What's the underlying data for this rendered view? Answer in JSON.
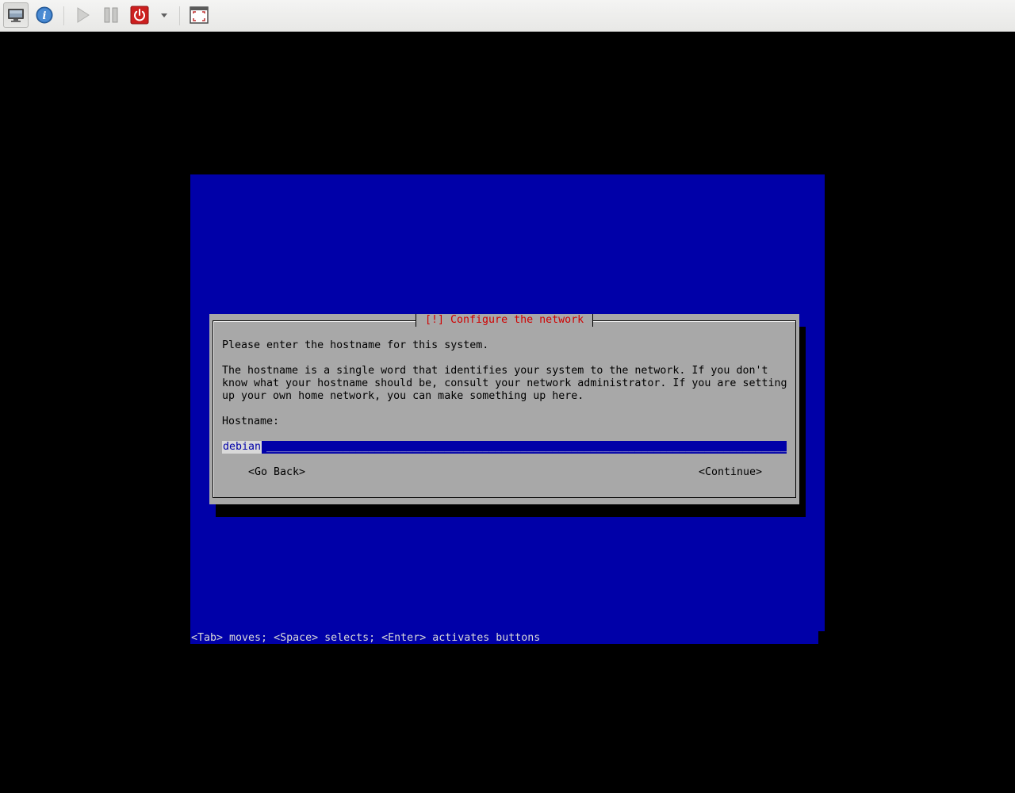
{
  "toolbar": {
    "items": [
      "display-icon",
      "info-icon",
      "play-icon",
      "pause-icon",
      "power-icon",
      "dropdown-icon",
      "fullscreen-icon"
    ]
  },
  "dialog": {
    "title": "[!] Configure the network",
    "prompt": "Please enter the hostname for this system.",
    "description": [
      "The hostname is a single word that identifies your system to the network. If you don't",
      "know what your hostname should be, consult your network administrator. If you are setting",
      "up your own home network, you can make something up here."
    ],
    "field_label": "Hostname:",
    "hostname_value": "debian",
    "go_back_label": "<Go Back>",
    "continue_label": "<Continue>"
  },
  "help_line": "<Tab> moves; <Space> selects; <Enter> activates buttons",
  "colors": {
    "console_bg": "#0000a8",
    "dialog_bg": "#a8a8a8",
    "title_red": "#d00000",
    "field_bg": "#0000a8",
    "field_text": "#d9d9d9"
  }
}
